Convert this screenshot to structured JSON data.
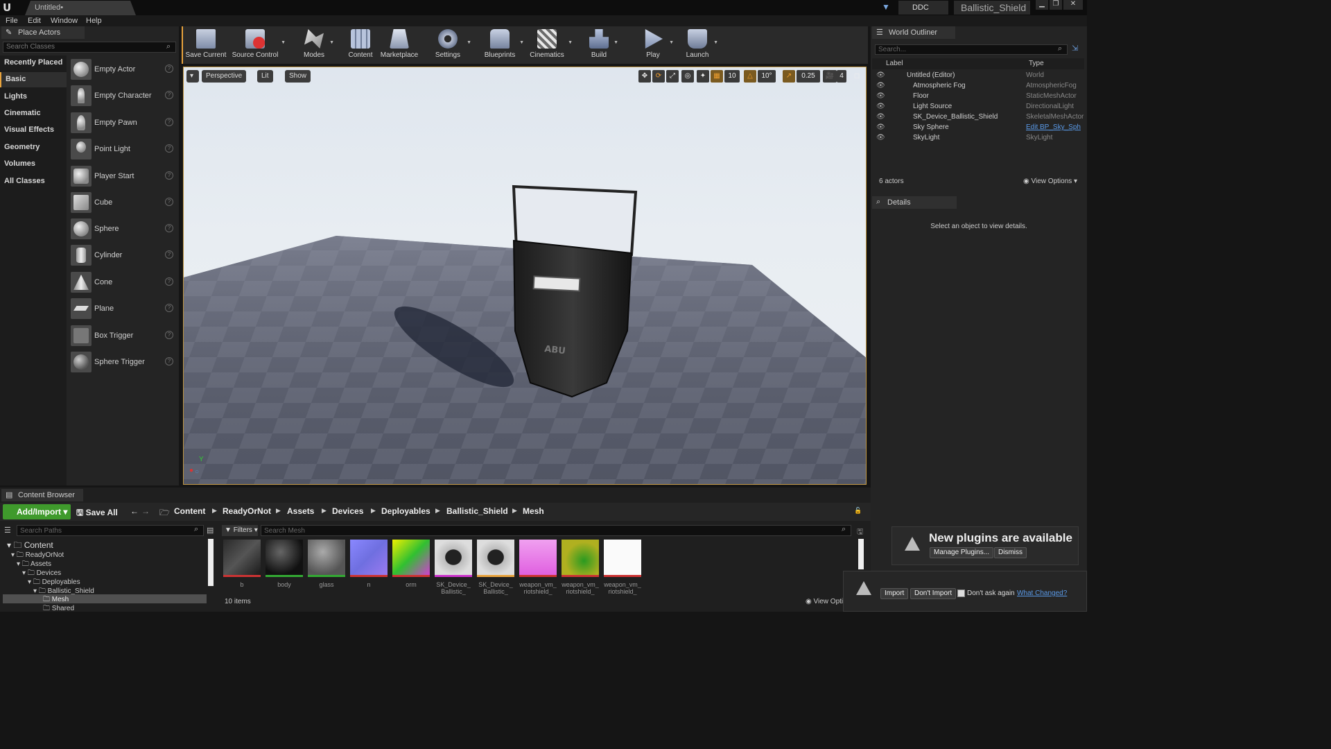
{
  "window": {
    "doc_tab": "Untitled•",
    "ddc_label": "DDC",
    "project_name": "Ballistic_Shield"
  },
  "menu": [
    "File",
    "Edit",
    "Window",
    "Help"
  ],
  "place_actors": {
    "tab_label": "Place Actors",
    "search_placeholder": "Search Classes",
    "categories": [
      "Recently Placed",
      "Basic",
      "Lights",
      "Cinematic",
      "Visual Effects",
      "Geometry",
      "Volumes",
      "All Classes"
    ],
    "active_category": "Basic",
    "actors": [
      "Empty Actor",
      "Empty Character",
      "Empty Pawn",
      "Point Light",
      "Player Start",
      "Cube",
      "Sphere",
      "Cylinder",
      "Cone",
      "Plane",
      "Box Trigger",
      "Sphere Trigger"
    ]
  },
  "toolbar": {
    "save_current": "Save Current",
    "source_control": "Source Control",
    "modes": "Modes",
    "content": "Content",
    "marketplace": "Marketplace",
    "settings": "Settings",
    "blueprints": "Blueprints",
    "cinematics": "Cinematics",
    "build": "Build",
    "play": "Play",
    "launch": "Launch"
  },
  "viewport": {
    "perspective": "Perspective",
    "lit": "Lit",
    "show": "Show",
    "grid_snap": "10",
    "rotation_snap": "10°",
    "scale_snap": "0.25",
    "camera_speed": "4",
    "shield_label": "ABU"
  },
  "outliner": {
    "tab_label": "World Outliner",
    "search_placeholder": "Search...",
    "col_label": "Label",
    "col_type": "Type",
    "rows": [
      {
        "label": "Untitled (Editor)",
        "type": "World"
      },
      {
        "label": "Atmospheric Fog",
        "type": "AtmosphericFog"
      },
      {
        "label": "Floor",
        "type": "StaticMeshActor"
      },
      {
        "label": "Light Source",
        "type": "DirectionalLight"
      },
      {
        "label": "SK_Device_Ballistic_Shield",
        "type": "SkeletalMeshActor"
      },
      {
        "label": "Sky Sphere",
        "type": "Edit BP_Sky_Sph"
      },
      {
        "label": "SkyLight",
        "type": "SkyLight"
      }
    ],
    "actor_count": "6 actors",
    "view_options": "View Options"
  },
  "details": {
    "tab_label": "Details",
    "message": "Select an object to view details."
  },
  "content_browser": {
    "tab_label": "Content Browser",
    "add_import": "Add/Import",
    "save_all": "Save All",
    "breadcrumbs": [
      "Content",
      "ReadyOrNot",
      "Assets",
      "Devices",
      "Deployables",
      "Ballistic_Shield",
      "Mesh"
    ],
    "search_paths_placeholder": "Search Paths",
    "filters": "Filters",
    "search_mesh_placeholder": "Search Mesh",
    "tree": [
      "Content",
      "ReadyOrNot",
      "Assets",
      "Devices",
      "Deployables",
      "Ballistic_Shield",
      "Mesh",
      "Shared"
    ],
    "assets": [
      {
        "label1": "b",
        "label2": ""
      },
      {
        "label1": "body",
        "label2": ""
      },
      {
        "label1": "glass",
        "label2": ""
      },
      {
        "label1": "n",
        "label2": ""
      },
      {
        "label1": "orm",
        "label2": ""
      },
      {
        "label1": "SK_Device_",
        "label2": "Ballistic_"
      },
      {
        "label1": "SK_Device_",
        "label2": "Ballistic_"
      },
      {
        "label1": "weapon_vm_",
        "label2": "riotshield_"
      },
      {
        "label1": "weapon_vm_",
        "label2": "riotshield_"
      },
      {
        "label1": "weapon_vm_",
        "label2": "riotshield_"
      }
    ],
    "item_count": "10 items",
    "view_options": "View Options"
  },
  "notifications": {
    "plugins_title": "New plugins are available",
    "manage_plugins": "Manage Plugins...",
    "dismiss": "Dismiss",
    "import": "Import",
    "dont_import": "Don't Import",
    "dont_ask": "Don't ask again",
    "what_changed": "What Changed?"
  },
  "colors": {
    "accent": "#e8a33d",
    "add_import_green": "#3f9a2c",
    "link_blue": "#5a9ae8"
  }
}
